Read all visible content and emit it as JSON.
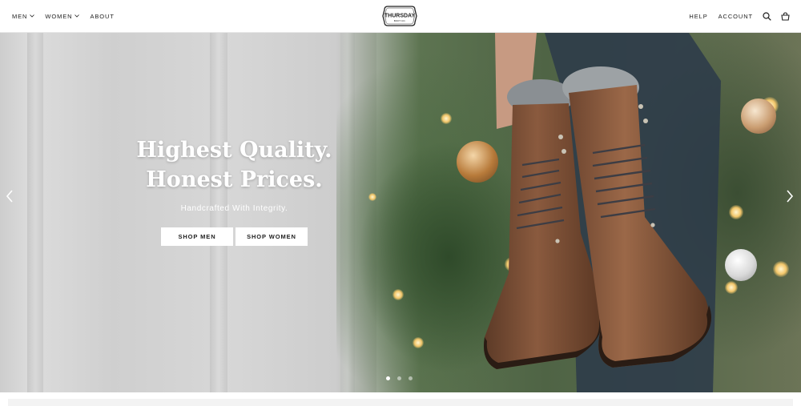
{
  "header": {
    "nav_left": [
      {
        "label": "MEN",
        "has_dropdown": true
      },
      {
        "label": "WOMEN",
        "has_dropdown": true
      },
      {
        "label": "ABOUT",
        "has_dropdown": false
      }
    ],
    "logo": {
      "text": "THURSDAY",
      "subtext": "BOOT CO."
    },
    "nav_right": [
      {
        "label": "HELP"
      },
      {
        "label": "ACCOUNT"
      }
    ],
    "icons": [
      "search-icon",
      "cart-icon"
    ]
  },
  "hero": {
    "headline_line1": "Highest Quality.",
    "headline_line2": "Honest Prices.",
    "subhead": "Handcrafted With Integrity.",
    "cta_men": "SHOP MEN",
    "cta_women": "SHOP WOMEN",
    "slides_total": 3,
    "active_slide": 1
  },
  "colors": {
    "header_bg": "#ffffff",
    "text": "#222222",
    "hero_text": "#ffffff",
    "cta_bg": "#ffffff",
    "boot_leather": "#7a5038"
  }
}
